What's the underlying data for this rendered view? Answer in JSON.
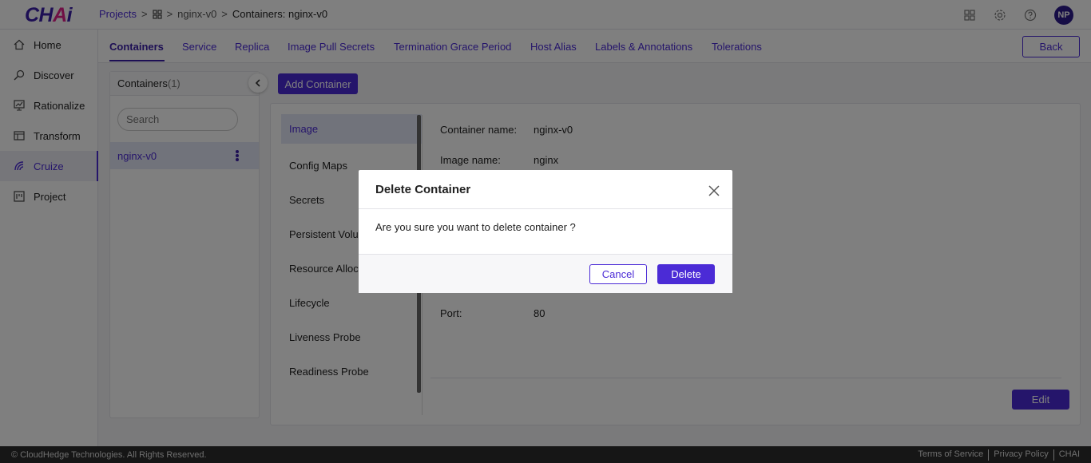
{
  "app": {
    "logo_text_1": "CH",
    "logo_text_2": "A",
    "logo_text_3": "i"
  },
  "breadcrumb": {
    "projects": "Projects",
    "sep": ">",
    "project_name": "nginx-v0",
    "current": "Containers: nginx-v0"
  },
  "topbar": {
    "icons": [
      "apps-grid-icon",
      "gear-icon",
      "help-icon"
    ],
    "avatar": "NP"
  },
  "sidebar": {
    "items": [
      {
        "label": "Home",
        "icon": "home-icon"
      },
      {
        "label": "Discover",
        "icon": "discover-icon"
      },
      {
        "label": "Rationalize",
        "icon": "rationalize-icon"
      },
      {
        "label": "Transform",
        "icon": "transform-icon"
      },
      {
        "label": "Cruize",
        "icon": "cruize-icon",
        "active": true
      },
      {
        "label": "Project",
        "icon": "project-icon"
      }
    ]
  },
  "tabs": {
    "items": [
      "Containers",
      "Service",
      "Replica",
      "Image Pull Secrets",
      "Termination Grace Period",
      "Host Alias",
      "Labels & Annotations",
      "Tolerations"
    ],
    "active": "Containers",
    "back_label": "Back"
  },
  "containers": {
    "title": "Containers",
    "count": "(1)",
    "search_placeholder": "Search",
    "add_label": "Add Container",
    "items": [
      "nginx-v0"
    ]
  },
  "sections": {
    "items": [
      "Image",
      "Config Maps",
      "Secrets",
      "Persistent Volu",
      "Resource Alloc",
      "Lifecycle",
      "Liveness Probe",
      "Readiness Probe"
    ],
    "active": "Image"
  },
  "details": {
    "container_name_label": "Container name:",
    "container_name_value": "nginx-v0",
    "image_name_label": "Image name:",
    "image_name_value": "nginx",
    "port_label": "Port:",
    "port_value": "80",
    "edit_label": "Edit"
  },
  "footer": {
    "copyright": "© CloudHedge Technologies. All Rights Reserved.",
    "links": [
      "Terms of Service",
      "Privacy Policy",
      "CHAI"
    ]
  },
  "modal": {
    "title": "Delete Container",
    "message": "Are you sure you want to delete container ?",
    "cancel_label": "Cancel",
    "delete_label": "Delete"
  },
  "colors": {
    "accent": "#4b2bd6",
    "accent_dark": "#3b1fa8",
    "logo_pink": "#e0218a"
  }
}
